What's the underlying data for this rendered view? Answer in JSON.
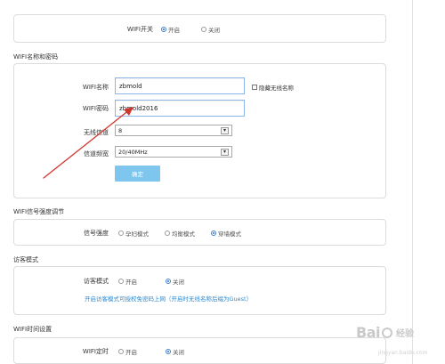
{
  "wifi_switch": {
    "label": "WIFI开关",
    "on_label": "开启",
    "off_label": "关闭",
    "selected": "on"
  },
  "name_password": {
    "section_title": "WIFI名称和密码",
    "name_label": "WIFI名称",
    "name_value": "zbmold",
    "hide_label": "隐藏无线名称",
    "hide_checked": false,
    "password_label": "WIFI密码",
    "password_value": "zbmold2016",
    "channel_label": "无线信道",
    "channel_value": "8",
    "bandwidth_label": "信道频宽",
    "bandwidth_value": "20/40MHz",
    "confirm_label": "确定"
  },
  "signal": {
    "section_title": "WIFI信号强度调节",
    "label": "信号强度",
    "options": [
      "孕妇模式",
      "均衡模式",
      "穿墙模式"
    ],
    "selected_index": 2
  },
  "guest": {
    "section_title": "访客模式",
    "label": "访客模式",
    "on_label": "开启",
    "off_label": "关闭",
    "selected": "off",
    "hint": "开启访客模式可授权免密码上网（开启时无线名称后缀为Guest）"
  },
  "timer": {
    "section_title": "WIFI时间设置",
    "label": "WIFI定时",
    "on_label": "开启",
    "off_label": "关闭",
    "selected": "off"
  },
  "watermark": {
    "brand": "Bai",
    "brand2": "经验",
    "url": "jingyan.baidu.com"
  },
  "colors": {
    "accent": "#2a6fc8",
    "button": "#7ec6ee",
    "annotation_arrow": "#d0342c",
    "hint_text": "#2f8bd0"
  }
}
